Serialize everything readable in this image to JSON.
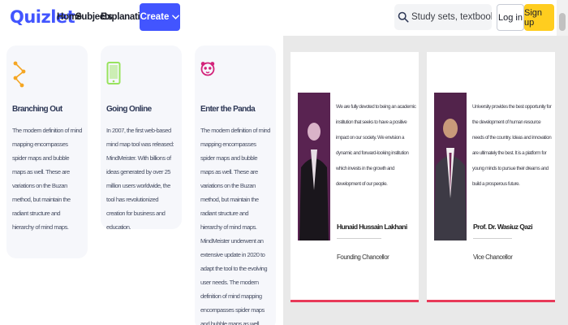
{
  "header": {
    "logo": "Quizlet",
    "nav": [
      "Home",
      "Subjects",
      "Explanations"
    ],
    "create_label": "Create",
    "search_placeholder": "Study sets, textbooks, ...",
    "login_label": "Log in",
    "signup_label": "Sign up"
  },
  "features": [
    {
      "title": "Branching Out",
      "body": "The modern definition of mind mapping encompasses spider maps and bubble maps as well. These are variations on the Buzan method, but maintain the radiant structure and hierarchy of mind maps.",
      "icon": "branch-icon"
    },
    {
      "title": "Going Online",
      "body": "In 2007, the first web-based mind map tool was released: MindMeister. With billions of ideas generated by over 25 million users worldwide, the tool has revolutionized creation for business and education.",
      "icon": "tablet-icon"
    },
    {
      "title": "Enter the Panda",
      "body": "The modern definition of mind mapping encompasses spider maps and bubble maps as well. These are variations on the Buzan method, but maintain the radiant structure and hierarchy of mind maps. MindMeister underwent an extensive update in 2020 to adapt the tool to the evolving user needs. The modern definition of mind mapping encompasses spider maps and bubble maps as well.",
      "icon": "panda-icon"
    }
  ],
  "profiles": [
    {
      "text": "We are fully devoted to being an academic institution that seeks to have a positive impact on our society. We envision a dynamic and forward-looking institution which invests in the growth and development of our people.",
      "name": "Hunaid Hussain Lakhani",
      "role": "Founding Chancellor"
    },
    {
      "text": "University provides the best opportunity for the development of human resource needs of the country. Ideas and innovation are ultimately the best. It is a platform for young minds to pursue their dreams and build a prosperous future.",
      "name": "Prof. Dr. Wasiuz Qazi",
      "role": "Vice Chancellor"
    }
  ],
  "colors": {
    "brand": "#4255ff",
    "signup": "#ffcd1f",
    "accent_orange": "#f5a623",
    "accent_green": "#98e35e",
    "accent_magenta": "#d3237a",
    "profile_bar": "#e83a59"
  }
}
